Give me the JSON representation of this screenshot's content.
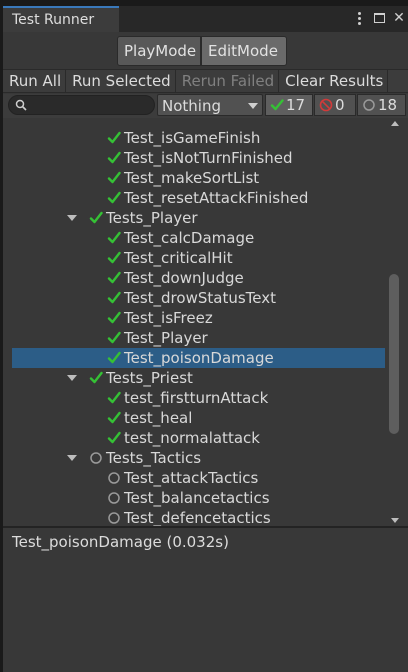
{
  "window": {
    "tab_title": "Test Runner",
    "controls": [
      "more-options-icon",
      "maximize-icon",
      "close-icon"
    ]
  },
  "mode": {
    "play_label": "PlayMode",
    "edit_label": "EditMode",
    "active": "EditMode"
  },
  "toolbar": {
    "run_all": "Run All",
    "run_selected": "Run Selected",
    "rerun_failed": "Rerun Failed",
    "clear_results": "Clear Results"
  },
  "filter": {
    "search_value": "",
    "category_selected": "Nothing",
    "passed_count": "17",
    "failed_count": "0",
    "not_run_count": "18"
  },
  "tree": {
    "rows": [
      {
        "label": "Test_isGameFinish",
        "status": "passed",
        "depth": 2
      },
      {
        "label": "Test_isNotTurnFinished",
        "status": "passed",
        "depth": 2
      },
      {
        "label": "Test_makeSortList",
        "status": "passed",
        "depth": 2
      },
      {
        "label": "Test_resetAttackFinished",
        "status": "passed",
        "depth": 2
      },
      {
        "label": "Tests_Player",
        "status": "passed",
        "depth": 1,
        "expanded": true
      },
      {
        "label": "Test_calcDamage",
        "status": "passed",
        "depth": 2
      },
      {
        "label": "Test_criticalHit",
        "status": "passed",
        "depth": 2
      },
      {
        "label": "Test_downJudge",
        "status": "passed",
        "depth": 2
      },
      {
        "label": "Test_drowStatusText",
        "status": "passed",
        "depth": 2
      },
      {
        "label": "Test_isFreez",
        "status": "passed",
        "depth": 2
      },
      {
        "label": "Test_Player",
        "status": "passed",
        "depth": 2
      },
      {
        "label": "Test_poisonDamage",
        "status": "passed",
        "depth": 2,
        "selected": true
      },
      {
        "label": "Tests_Priest",
        "status": "passed",
        "depth": 1,
        "expanded": true
      },
      {
        "label": "test_firstturnAttack",
        "status": "passed",
        "depth": 2
      },
      {
        "label": "test_heal",
        "status": "passed",
        "depth": 2
      },
      {
        "label": "test_normalattack",
        "status": "passed",
        "depth": 2
      },
      {
        "label": "Tests_Tactics",
        "status": "notrun",
        "depth": 1,
        "expanded": true
      },
      {
        "label": "Test_attackTactics",
        "status": "notrun",
        "depth": 2
      },
      {
        "label": "Test_balancetactics",
        "status": "notrun",
        "depth": 2
      },
      {
        "label": "Test_defencetactics",
        "status": "notrun",
        "depth": 2
      }
    ]
  },
  "details": {
    "result_text": "Test_poisonDamage (0.032s)"
  },
  "colors": {
    "pass": "#35c135",
    "fail": "#d23a3a",
    "selection": "#2c5d87",
    "tab_accent": "#3a79bb"
  }
}
